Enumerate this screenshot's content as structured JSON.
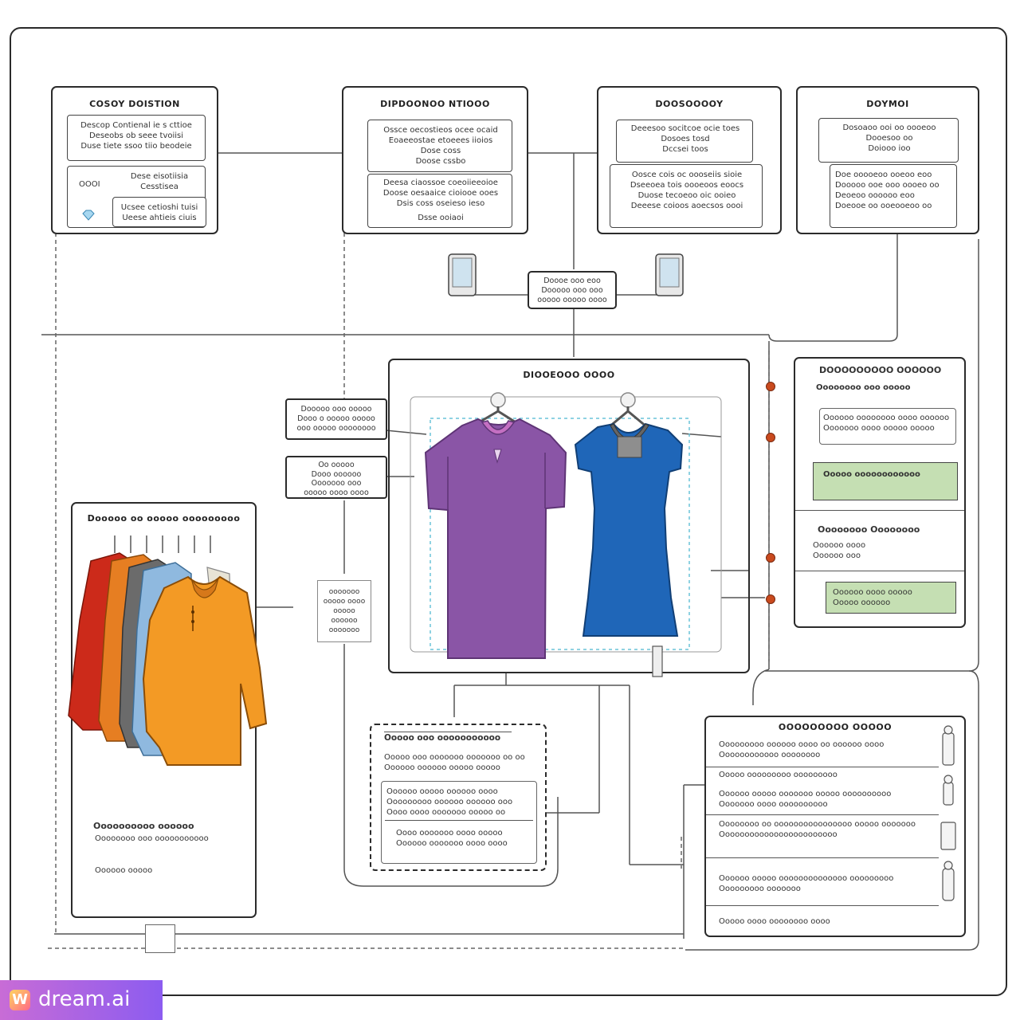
{
  "top_boxes": [
    {
      "title": "COSOY DOISTION",
      "sections": [
        {
          "text": "Descop Contienal ie s cttioe\nDeseobs ob seee tvoiisi\nDuse tiete ssoo tiio beodeie"
        },
        {
          "label": "OOOI",
          "text": "Dese eisotiisia\nCesstisea"
        },
        {
          "text": "Ucsee cetioshi tuisi\nUeese ahtieis ciuis"
        }
      ]
    },
    {
      "title": "DIPDOONOO NTIOOO",
      "sections": [
        {
          "text": "Ossce oecostieos ocee ocaid\nEoaeeostae etoeees iioios\nDose coss\nDoose cssbo"
        },
        {
          "text": "Deesa ciaossoe coeoiieeoioe\nDoose oesaaice cioiooe ooes\nDsis coss oseieso ieso"
        },
        {
          "text": "Dsse ooiaoi"
        }
      ]
    },
    {
      "title": "DOOSOOOOY",
      "sections": [
        {
          "text": "Deeesoo socitcoe ocie toes\nDosoes tosd\nDccsei toos"
        },
        {
          "text": "Oosce cois oc oooseiis sioie\nDseeoea tois oooeoos eoocs\nDuose tecoeoo oic ooieo\nDeeese coioos aoecsos oooi"
        }
      ]
    },
    {
      "title": "DOYMOI",
      "sections": [
        {
          "text": "Dosoaoo ooi oo oooeoo\nDooesoo oo\nDoiooo ioo"
        },
        {
          "text": "Doe ooooeoo ooeoo eoo\nDooooo ooe ooo oooeo oo\nDeoeoo oooooo eoo\nDoeooe oo ooeooeoo oo"
        }
      ]
    }
  ],
  "hub": {
    "text": "Doooe ooo eoo\nDooooo ooo ooo\nooooo ooooo oooo"
  },
  "center_panel": {
    "title": "DIOOEOOO OOOO"
  },
  "left_notes": [
    {
      "text": "Dooooo ooo ooooo\nDooo o ooooo ooooo\nooo ooooo oooooooo"
    },
    {
      "text": "Oo ooooo\nDooo oooooo\nOoooooo ooo\nooooo oooo oooo"
    }
  ],
  "small_note": {
    "text": "ooooooo\nooooo oooo\nooooo\noooooo\nooooooo"
  },
  "wardrobe_panel": {
    "title": "Dooooo oo ooooo ooooooooo",
    "footer_title": "Oooooooooo oooooo",
    "footer_text": "Oooooooo ooo ooooooooooo",
    "footer_note": "Oooooo ooooo"
  },
  "right_panel": {
    "title1": "DOOOOOOOOO OOOOOO",
    "sub1": "Oooooooo ooo ooooo",
    "item1": "Oooooo oooooooo oooo oooooo\nOoooooo oooo ooooo ooooo",
    "green1": "Ooooo oooooooooooo",
    "title2": "Oooooooo Oooooooo",
    "sub2": "Oooooo oooo\nOooooo ooo",
    "green2": "Oooooo oooo ooooo\nOoooo oooooo"
  },
  "bottom_middle": {
    "header": "Ooooo ooo ooooooooooo",
    "text1": "Ooooo ooo ooooooo ooooooo oo oo\nOooooo oooooo ooooo ooooo",
    "text2": "Oooooo ooooo oooooo oooo\nOoooooooo oooooo oooooo ooo\nOooo oooo ooooooo ooooo oo",
    "text3": "Oooo ooooooo oooo ooooo\nOooooo ooooooo oooo oooo"
  },
  "bottom_right": {
    "title": "OOOOOOOOO OOOOO",
    "rows": [
      "Ooooooooo oooooo oooo oo oooooo oooo\nOooooooooooo oooooooo",
      "Ooooo ooooooooo ooooooooo",
      "Oooooo ooooo ooooooo ooooo oooooooooo\nOoooooo oooo oooooooooo",
      "Oooooooo oo oooooooooooooooo ooooo ooooooo\nOooooooooooooooooooooooo",
      "Oooooo ooooo oooooooooooooo ooooooooo\nOoooooooo ooooooo",
      "Ooooo oooo oooooooo oooo"
    ]
  },
  "colors": {
    "purple_shirt": "#8a55a6",
    "blue_dress": "#1f66b8",
    "orange_shirt": "#f39a25",
    "red_shirt": "#cc2a1a",
    "green_fill": "#c5dfb3",
    "dot": "#c94a1e"
  },
  "watermark": {
    "text": "dream.ai",
    "icon": "W"
  }
}
